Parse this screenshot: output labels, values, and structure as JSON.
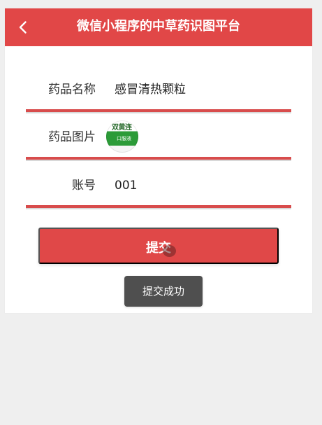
{
  "header": {
    "title": "微信小程序的中草药识图平台"
  },
  "form": {
    "rows": [
      {
        "label": "药品名称",
        "value": "感冒清热颗粒"
      },
      {
        "label": "药品图片",
        "image_text": "双黄连",
        "image_subtext": "口服液"
      },
      {
        "label": "账号",
        "value": "001"
      }
    ]
  },
  "actions": {
    "submit_label": "提交"
  },
  "toast": {
    "message": "提交成功"
  },
  "colors": {
    "accent": "#e14747",
    "toast": "#4f4f4f"
  },
  "icons": {
    "back": "chevron-left-icon"
  }
}
